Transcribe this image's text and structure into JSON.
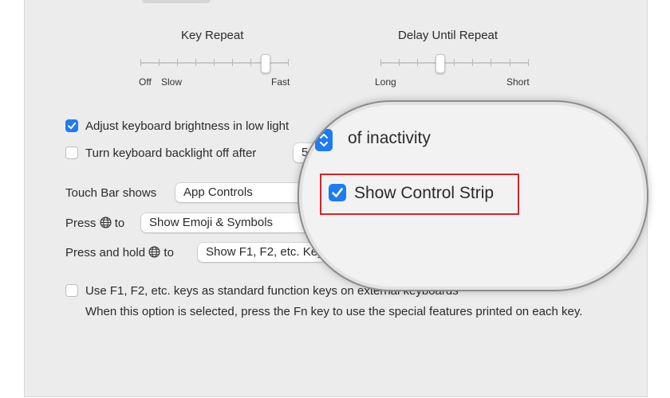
{
  "key_repeat": {
    "title": "Key Repeat",
    "labels": [
      "Off",
      "Slow",
      "Fast"
    ],
    "value_tick": 7,
    "ticks": 9
  },
  "delay_repeat": {
    "title": "Delay Until Repeat",
    "labels": [
      "Long",
      "Short"
    ],
    "value_tick": 3,
    "ticks": 9
  },
  "options": {
    "adjust_brightness": {
      "label": "Adjust keyboard brightness in low light",
      "checked": true
    },
    "backlight_off": {
      "label": "Turn keyboard backlight off after",
      "checked": false,
      "popup_value": "5"
    },
    "fn_keys": {
      "label": "Use F1, F2, etc. keys as standard function keys on external keyboards",
      "checked": false
    },
    "fn_help": "When this option is selected, press the Fn key to use the special features printed on each key."
  },
  "touch_bar": {
    "label": "Touch Bar shows",
    "value": "App Controls"
  },
  "press_globe": {
    "label_before": "Press",
    "label_after": "to",
    "value": "Show Emoji & Symbols"
  },
  "press_hold_globe": {
    "label_before": "Press and hold",
    "label_after": "to",
    "value": "Show F1, F2, etc. Keys"
  },
  "magnifier": {
    "inactivity_text": "of inactivity",
    "show_control_strip": {
      "label": "Show Control Strip",
      "checked": true
    }
  },
  "colors": {
    "accent": "#1f7bf4",
    "highlight": "#d6242b"
  }
}
